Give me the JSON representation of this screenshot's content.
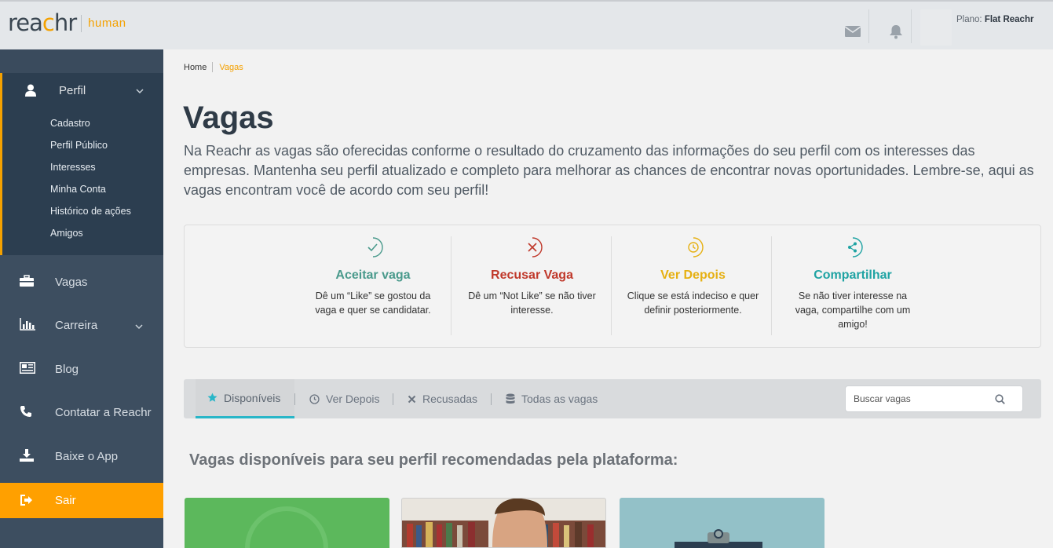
{
  "header": {
    "logo_main": "reachr",
    "logo_sub": "human",
    "plan_label": "Plano:",
    "plan_value": "Flat Reachr"
  },
  "sidebar": {
    "perfil": {
      "label": "Perfil",
      "submenu": [
        "Cadastro",
        "Perfil Público",
        "Interesses",
        "Minha Conta",
        "Histórico de ações",
        "Amigos"
      ]
    },
    "items": [
      {
        "label": "Vagas"
      },
      {
        "label": "Carreira"
      },
      {
        "label": "Blog"
      },
      {
        "label": "Contatar a Reachr"
      },
      {
        "label": "Baixe o App"
      },
      {
        "label": "Sair"
      }
    ]
  },
  "breadcrumb": {
    "home": "Home",
    "current": "Vagas"
  },
  "page": {
    "title": "Vagas",
    "description": "Na Reachr as vagas são oferecidas conforme o resultado do cruzamento das informações do seu perfil com os interesses das empresas. Mantenha seu perfil atualizado e completo para melhorar as chances de encontrar novas oportunidades. Lembre-se, aqui as vagas encontram você de acordo com seu perfil!"
  },
  "actions": [
    {
      "title": "Aceitar vaga",
      "desc": "Dê um “Like” se gostou da vaga e quer se candidatar.",
      "color": "#4a9a8c",
      "icon": "check-icon"
    },
    {
      "title": "Recusar Vaga",
      "desc": "Dê um “Not Like” se não tiver interesse.",
      "color": "#c0392b",
      "icon": "x-icon"
    },
    {
      "title": "Ver Depois",
      "desc": "Clique se está indeciso e quer definir posteriormente.",
      "color": "#e6b012",
      "icon": "clock-icon"
    },
    {
      "title": "Compartilhar",
      "desc": "Se não tiver interesse na vaga, compartilhe com um amigo!",
      "color": "#1fa3a3",
      "icon": "share-icon"
    }
  ],
  "tabs": [
    {
      "label": "Disponíveis",
      "icon": "star-icon",
      "active": true
    },
    {
      "label": "Ver Depois",
      "icon": "clock-icon"
    },
    {
      "label": "Recusadas",
      "icon": "x-icon"
    },
    {
      "label": "Todas as vagas",
      "icon": "database-icon"
    }
  ],
  "search": {
    "placeholder": "Buscar vagas"
  },
  "section": {
    "title": "Vagas disponíveis para seu perfil recomendadas pela plataforma:"
  }
}
